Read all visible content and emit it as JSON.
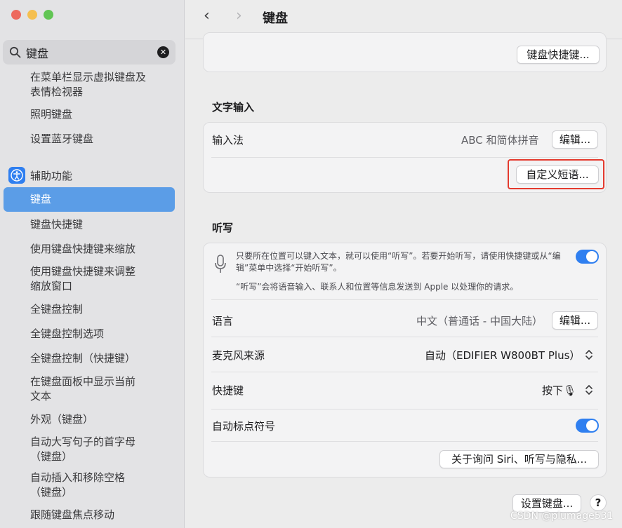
{
  "window": {
    "title": "键盘",
    "traffic_colors": [
      "#ed6a5e",
      "#f5bf4f",
      "#61c554"
    ]
  },
  "sidebar": {
    "search": {
      "value": "键盘",
      "icon": "magnifier-icon",
      "clear_icon": "clear-icon"
    },
    "results_top": [
      "在菜单栏显示虚拟键盘及\n表情检视器",
      "照明键盘",
      "设置蓝牙键盘"
    ],
    "group": {
      "label": "辅助功能",
      "icon": "accessibility-icon"
    },
    "results_group": [
      "键盘",
      "键盘快捷键",
      "使用键盘快捷键来缩放",
      "使用键盘快捷键来调整\n缩放窗口",
      "全键盘控制",
      "全键盘控制选项",
      "全键盘控制（快捷键）",
      "在键盘面板中显示当前\n文本",
      "外观（键盘）",
      "自动大写句子的首字母\n（键盘）",
      "自动插入和移除空格\n（键盘）",
      "跟随键盘焦点移动"
    ],
    "selected_index": 0
  },
  "toolbar": {
    "back": "‹",
    "forward": "›",
    "title": "键盘"
  },
  "top_card": {
    "shortcuts_button": "键盘快捷键..."
  },
  "text_input": {
    "header": "文字输入",
    "input_method_label": "输入法",
    "input_method_value": "ABC 和简体拼音",
    "edit_button": "编辑...",
    "custom_phrases_button": "自定义短语..."
  },
  "dictation": {
    "header": "听写",
    "description": "只要所在位置可以键入文本，就可以使用“听写”。若要开始听写，请使用快捷键或从“编辑”菜单中选择“开始听写”。",
    "privacy_note": "“听写”会将语音输入、联系人和位置等信息发送到 Apple 以处理你的请求。",
    "enabled": true,
    "language_label": "语言",
    "language_value": "中文（普通话 - 中国大陆）",
    "language_edit": "编辑...",
    "mic_label": "麦克风来源",
    "mic_value": "自动（EDIFIER W800BT Plus）",
    "shortcut_label": "快捷键",
    "shortcut_value": "按下🎙",
    "auto_punct_label": "自动标点符号",
    "auto_punct_enabled": true,
    "about_button": "关于询问 Siri、听写与隐私..."
  },
  "footer": {
    "setup_button": "设置键盘...",
    "help": "?"
  },
  "watermark": "CSDN @plumage531",
  "colors": {
    "accent": "#2f7ff0",
    "selection": "#5b9de7",
    "highlight": "#e43a2e"
  }
}
